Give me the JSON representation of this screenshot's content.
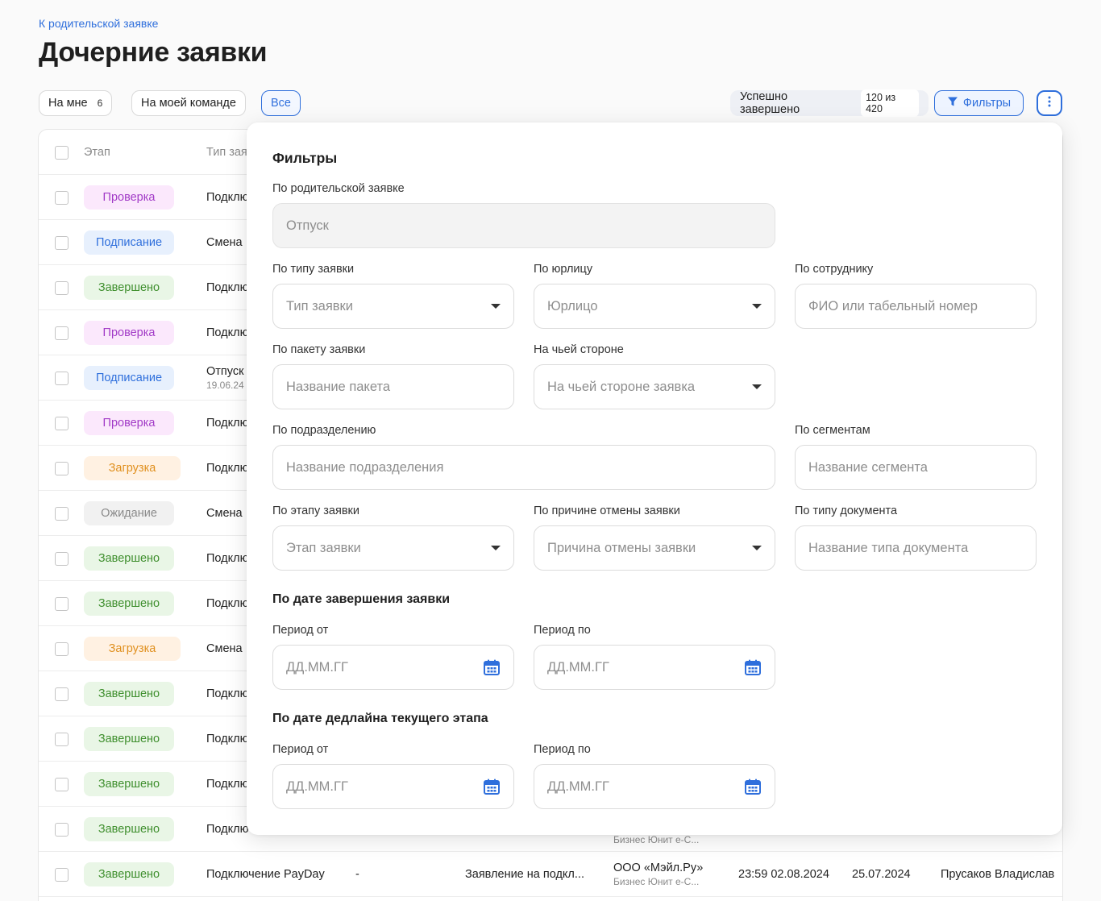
{
  "header": {
    "back_link": "К родительской заявке",
    "title": "Дочерние заявки"
  },
  "toolbar": {
    "chip_mine": "На мне",
    "chip_mine_count": "6",
    "chip_team": "На моей команде",
    "chip_all": "Все",
    "status_label": "Успешно завершено",
    "status_count": "120 из 420",
    "filters_label": "Фильтры"
  },
  "table": {
    "headers": {
      "stage": "Этап",
      "type": "Тип зая"
    },
    "rows": [
      {
        "stage": "Проверка",
        "status": "check",
        "type": "Подклю",
        "sub": ""
      },
      {
        "stage": "Подписание",
        "status": "sign",
        "type": "Смена",
        "sub": ""
      },
      {
        "stage": "Завершено",
        "status": "done",
        "type": "Подклю",
        "sub": ""
      },
      {
        "stage": "Проверка",
        "status": "check",
        "type": "Подклю",
        "sub": ""
      },
      {
        "stage": "Подписание",
        "status": "sign",
        "type": "Отпуск",
        "sub": "19.06.24"
      },
      {
        "stage": "Проверка",
        "status": "check",
        "type": "Подклю",
        "sub": ""
      },
      {
        "stage": "Загрузка",
        "status": "upload",
        "type": "Подклю",
        "sub": ""
      },
      {
        "stage": "Ожидание",
        "status": "wait",
        "type": "Смена",
        "sub": ""
      },
      {
        "stage": "Завершено",
        "status": "done",
        "type": "Подклю",
        "sub": ""
      },
      {
        "stage": "Завершено",
        "status": "done",
        "type": "Подклю",
        "sub": ""
      },
      {
        "stage": "Загрузка",
        "status": "upload",
        "type": "Смена",
        "sub": ""
      },
      {
        "stage": "Завершено",
        "status": "done",
        "type": "Подклю",
        "sub": ""
      },
      {
        "stage": "Завершено",
        "status": "done",
        "type": "Подклю",
        "sub": ""
      },
      {
        "stage": "Завершено",
        "status": "done",
        "type": "Подклю",
        "sub": ""
      },
      {
        "stage": "Завершено",
        "status": "done",
        "type": "Подклю",
        "sub": ""
      }
    ],
    "peek_company_sub": "Бизнес Юнит е-С...",
    "last_row": {
      "stage": "Завершено",
      "type": "Подключение PayDay",
      "dash": "-",
      "document": "Заявление на подкл...",
      "company": "ООО «Мэйл.Ру»",
      "company_sub": "Бизнес Юнит е-С...",
      "datetime": "23:59 02.08.2024",
      "date": "25.07.2024",
      "employee": "Прусаков Владислав"
    }
  },
  "filters": {
    "title": "Фильтры",
    "parent_label": "По родительской заявке",
    "parent_value": "Отпуск",
    "type_label": "По типу заявки",
    "type_ph": "Тип заявки",
    "entity_label": "По юрлицу",
    "entity_ph": "Юрлицо",
    "employee_label": "По сотруднику",
    "employee_ph": "ФИО или табельный номер",
    "package_label": "По пакету заявки",
    "package_ph": "Название пакета",
    "side_label": "На чьей стороне",
    "side_ph": "На чьей стороне заявка",
    "division_label": "По подразделению",
    "division_ph": "Название подразделения",
    "segments_label": "По сегментам",
    "segments_ph": "Название сегмента",
    "stage_label": "По этапу заявки",
    "stage_ph": "Этап заявки",
    "cancel_label": "По причине отмены заявки",
    "cancel_ph": "Причина отмены заявки",
    "doctype_label": "По типу документа",
    "doctype_ph": "Название типа документа",
    "completion_section": "По дате завершения заявки",
    "deadline_section": "По дате дедлайна текущего этапа",
    "period_from": "Период от",
    "period_to": "Период по",
    "date_ph": "ДД.ММ.ГГ"
  },
  "colors": {
    "accent": "#2f6fdc",
    "check_bg": "#fbe8fc",
    "check_fg": "#a23bc7",
    "sign_bg": "#e7f0fd",
    "sign_fg": "#2f6fdc",
    "done_bg": "#e9f6e6",
    "done_fg": "#3f8f2e",
    "upload_bg": "#fff1e2",
    "upload_fg": "#e0901f",
    "wait_bg": "#f1f1f1",
    "wait_fg": "#8a8a8a"
  }
}
